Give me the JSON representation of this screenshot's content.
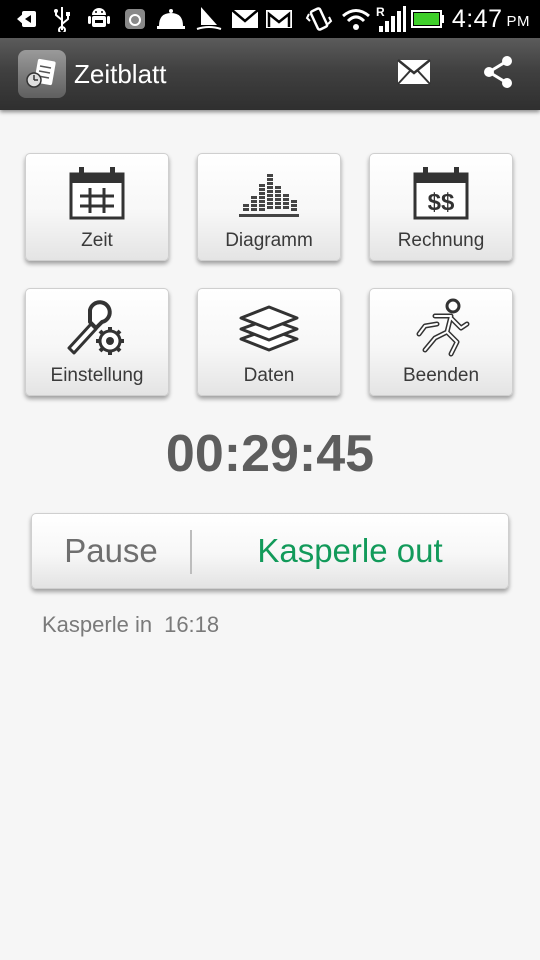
{
  "statusbar": {
    "time": "4:47",
    "ampm": "PM",
    "icons": [
      "back-icon",
      "usb-icon",
      "android-debug-icon",
      "app-notification-icon",
      "bell-icon",
      "sailing-icon",
      "mail-icon",
      "gmail-icon",
      "vibrate-icon",
      "wifi-icon",
      "roaming-signal-icon",
      "battery-icon"
    ]
  },
  "actionbar": {
    "title": "Zeitblatt",
    "actions": [
      "mail-icon",
      "share-icon"
    ]
  },
  "tiles": [
    {
      "label": "Zeit",
      "icon": "calendar-grid-icon"
    },
    {
      "label": "Diagramm",
      "icon": "bar-chart-icon"
    },
    {
      "label": "Rechnung",
      "icon": "calendar-dollar-icon"
    },
    {
      "label": "Einstellung",
      "icon": "wrench-gear-icon"
    },
    {
      "label": "Daten",
      "icon": "layers-icon"
    },
    {
      "label": "Beenden",
      "icon": "running-man-icon"
    }
  ],
  "timer": "00:29:45",
  "punch": {
    "pause_label": "Pause",
    "out_label": "Kasperle out",
    "out_color": "#129a5a"
  },
  "status": {
    "label": "Kasperle in",
    "time": "16:18"
  }
}
